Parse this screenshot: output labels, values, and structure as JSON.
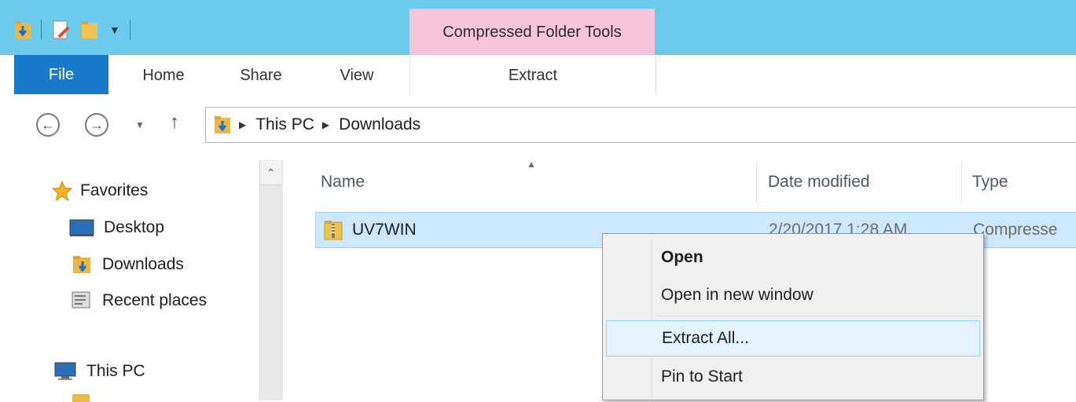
{
  "title_bar": {
    "contextual_tab_label": "Compressed Folder Tools"
  },
  "ribbon": {
    "tabs": [
      {
        "label": "File"
      },
      {
        "label": "Home"
      },
      {
        "label": "Share"
      },
      {
        "label": "View"
      },
      {
        "label": "Extract"
      }
    ]
  },
  "address_bar": {
    "crumbs": [
      "This PC",
      "Downloads"
    ]
  },
  "nav_pane": {
    "items": [
      {
        "label": "Favorites",
        "icon": "star-icon"
      },
      {
        "label": "Desktop",
        "icon": "desktop-icon"
      },
      {
        "label": "Downloads",
        "icon": "downloads-folder-icon"
      },
      {
        "label": "Recent places",
        "icon": "recent-places-icon"
      },
      {
        "label": "This PC",
        "icon": "computer-icon"
      }
    ]
  },
  "file_list": {
    "columns": [
      "Name",
      "Date modified",
      "Type"
    ],
    "rows": [
      {
        "name": "UV7WIN",
        "date_modified": "2/20/2017 1:28 AM",
        "type": "Compresse"
      }
    ]
  },
  "context_menu": {
    "items": [
      {
        "label": "Open"
      },
      {
        "label": "Open in new window"
      },
      {
        "label": "Extract All..."
      },
      {
        "label": "Pin to Start"
      }
    ]
  },
  "colors": {
    "title_bar": "#6ccbea",
    "contextual_tab": "#f7c4dc",
    "file_tab": "#1979ca",
    "selection": "#cce8ff"
  }
}
